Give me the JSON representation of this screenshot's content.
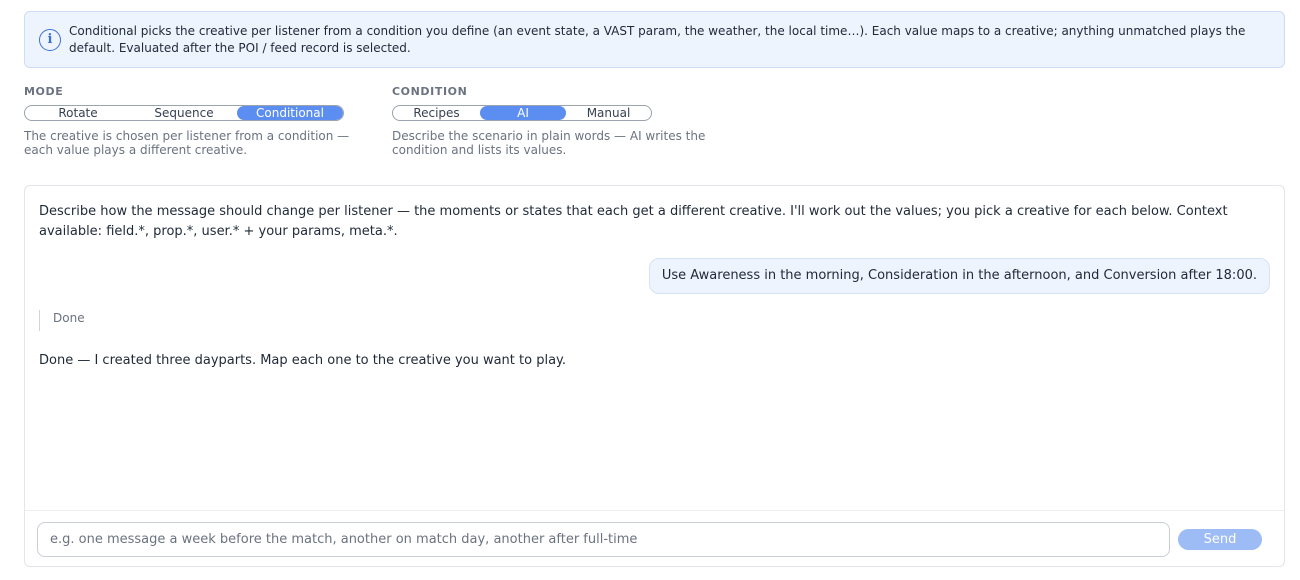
{
  "info": {
    "text": "Conditional picks the creative per listener from a condition you define (an event state, a VAST param, the weather, the local time…). Each value maps to a creative; anything unmatched plays the default. Evaluated after the POI / feed record is selected.",
    "icon": "info-circle-icon"
  },
  "mode": {
    "label": "MODE",
    "options": [
      "Rotate",
      "Sequence",
      "Conditional"
    ],
    "selected": "Conditional",
    "description": "The creative is chosen per listener from a condition — each value plays a different creative."
  },
  "condition": {
    "label": "CONDITION",
    "options": [
      "Recipes",
      "AI",
      "Manual"
    ],
    "selected": "AI",
    "description": "Describe the scenario in plain words — AI writes the condition and lists its values."
  },
  "chat": {
    "intro": "Describe how the message should change per listener — the moments or states that each get a different creative. I'll work out the values; you pick a creative for each below. Context available: field.*, prop.*, user.* + your params, meta.*.",
    "user_message": "Use Awareness in the morning, Consideration in the afternoon, and Conversion after 18:00.",
    "status": "Done",
    "assistant_message": "Done — I created three dayparts. Map each one to the creative you want to play.",
    "input_placeholder": "e.g. one message a week before the match, another on match day, another after full-time",
    "input_value": "",
    "send_label": "Send"
  },
  "colors": {
    "accent": "#5b8ef0",
    "send_disabled": "#9dbcf5",
    "banner_bg": "#eef4fe"
  }
}
